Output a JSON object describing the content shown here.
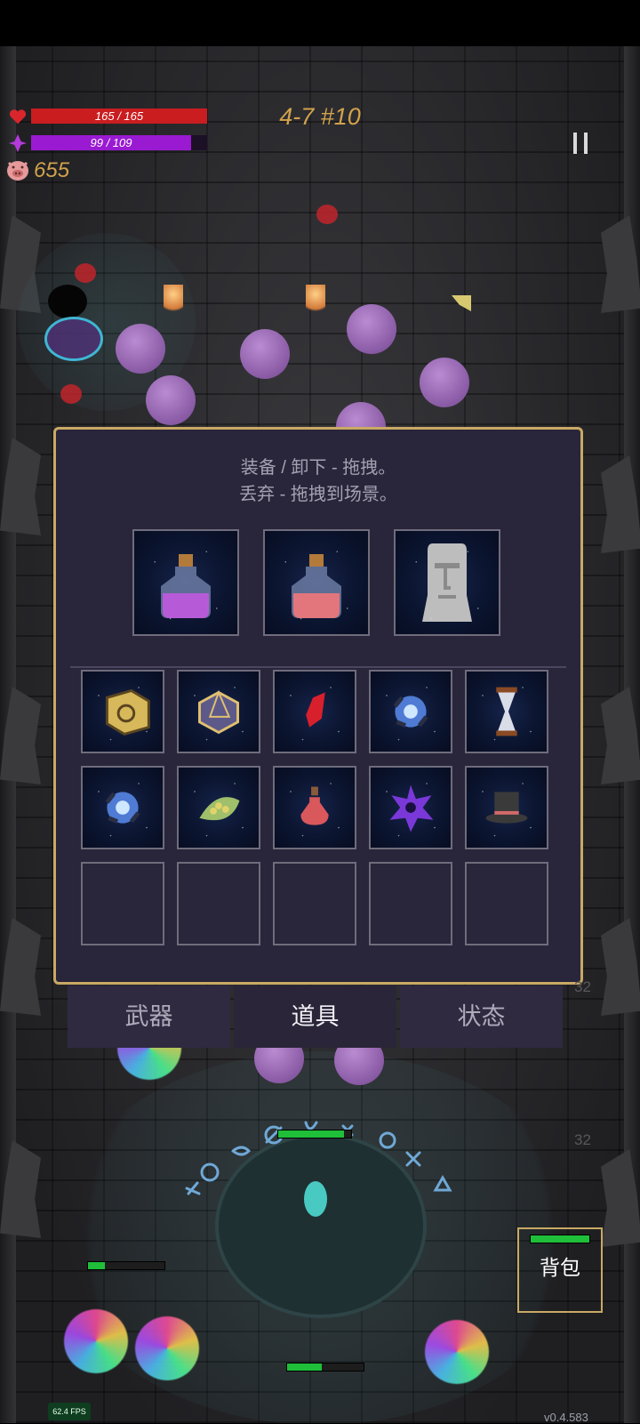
{
  "hud": {
    "hp_text": "165 / 165",
    "hp_fraction": 1.0,
    "mp_text": "99 / 109",
    "mp_fraction": 0.908,
    "gold": "655",
    "stage": "4-7 #10",
    "colors": {
      "hp": "#c91d20",
      "mp": "#9a1ad1",
      "gold": "#d2a24c"
    }
  },
  "inventory": {
    "hint_line1": "装备 / 卸下 - 拖拽。",
    "hint_line2": "丢弃 - 拖拽到场景。",
    "equipped": [
      {
        "icon": "purple-potion-icon"
      },
      {
        "icon": "red-potion-icon"
      },
      {
        "icon": "moai-statue-icon"
      }
    ],
    "items": [
      {
        "icon": "golden-sun-cube-icon"
      },
      {
        "icon": "d20-dice-icon"
      },
      {
        "icon": "red-crystal-icon"
      },
      {
        "icon": "blue-energy-core-icon"
      },
      {
        "icon": "hourglass-icon"
      },
      {
        "icon": "blue-energy-core-icon"
      },
      {
        "icon": "green-leaf-icon"
      },
      {
        "icon": "red-flask-icon"
      },
      {
        "icon": "purple-shuriken-icon"
      },
      {
        "icon": "top-hat-icon"
      },
      null,
      null,
      null,
      null,
      null
    ]
  },
  "tabs": [
    {
      "label": "武器",
      "active": false
    },
    {
      "label": "道具",
      "active": true
    },
    {
      "label": "状态",
      "active": false
    }
  ],
  "backpack": {
    "label": "背包"
  },
  "side_counts": [
    "32",
    "32"
  ],
  "fps": "62.4 FPS",
  "version": "v0.4.583"
}
